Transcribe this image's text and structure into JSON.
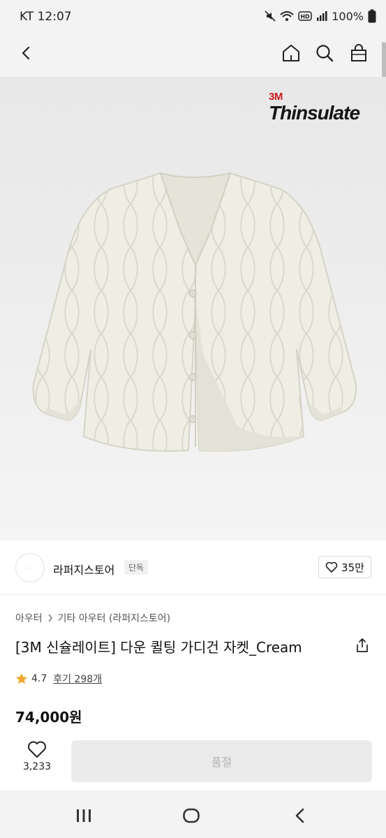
{
  "status_bar": {
    "carrier_time": "KT 12:07",
    "battery": "100%",
    "icons": [
      "mute-icon",
      "wifi-icon",
      "hd-icon",
      "signal-icon",
      "battery-icon"
    ]
  },
  "app_bar": {
    "icons": [
      "back-arrow-icon",
      "home-icon",
      "search-icon",
      "shopping-bag-icon"
    ]
  },
  "hero": {
    "brand_mark": "3M",
    "brand_name": "Thinsulate"
  },
  "store": {
    "name": "라퍼지스토어",
    "badge": "단독",
    "likes": "35만"
  },
  "breadcrumb": {
    "category": "아우터",
    "subcategory": "기타 아우터 (라퍼지스토어)"
  },
  "product": {
    "title": "[3M 신슐레이트] 다운 퀼팅 가디건 자켓_Cream",
    "rating": "4.7",
    "reviews": "후기 298개",
    "price": "74,000원"
  },
  "buy_bar": {
    "like_count": "3,233",
    "soldout_label": "품절"
  },
  "nav_bar": {
    "icons": [
      "recent-apps-icon",
      "home-circle-icon",
      "back-chevron-icon"
    ]
  },
  "colors": {
    "rating_star": "#f0a72c",
    "brand_red": "#d0191e",
    "jacket_cream": "#efeee4"
  }
}
